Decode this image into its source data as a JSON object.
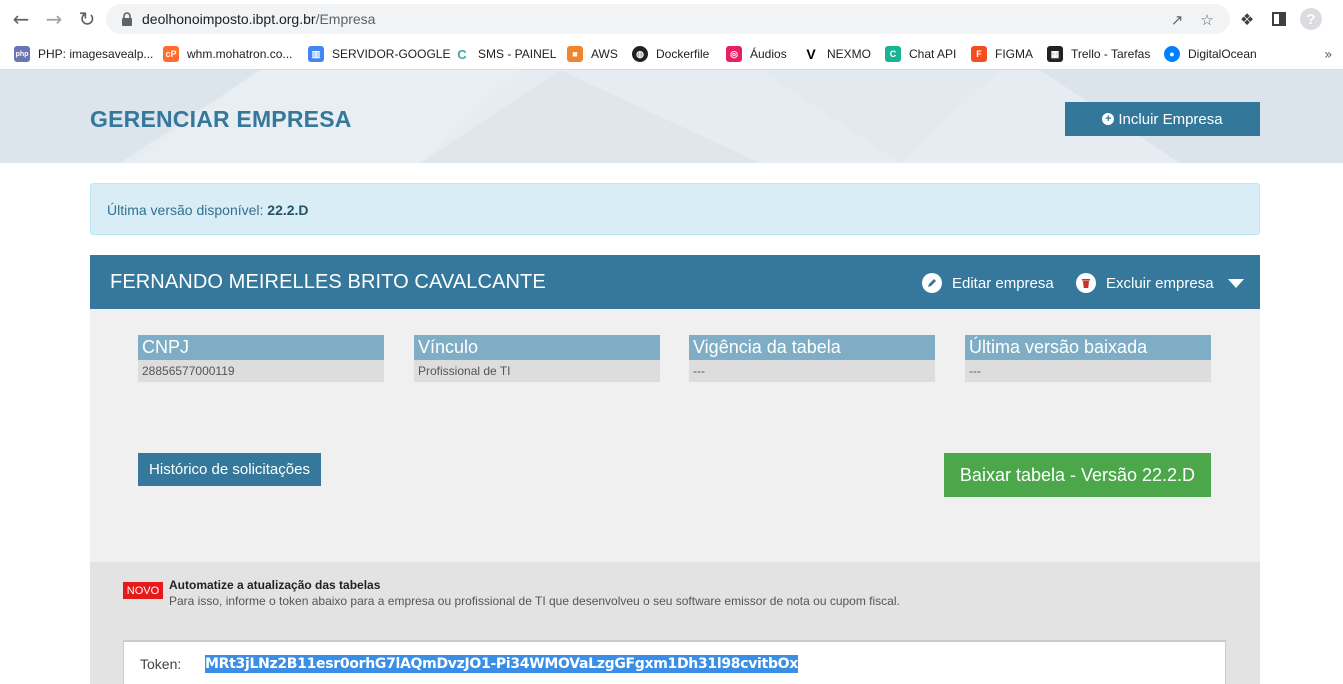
{
  "browser": {
    "url_host": "deolhonoimposto.ibpt.org.br",
    "url_path": "/Empresa",
    "bookmarks": [
      {
        "label": "PHP: imagesavealp...",
        "icon": "php-icon",
        "color": "#6b74b5"
      },
      {
        "label": "whm.mohatron.co...",
        "icon": "cpanel-icon",
        "color": "#ff6c2c"
      },
      {
        "label": "SERVIDOR-GOOGLE",
        "icon": "google-cloud-icon",
        "color": "#4285f4"
      },
      {
        "label": "SMS - PAINEL",
        "icon": "sms-icon",
        "color": "#3aa8a8"
      },
      {
        "label": "AWS",
        "icon": "aws-icon",
        "color": "#f0852d"
      },
      {
        "label": "Dockerfile",
        "icon": "globe-icon",
        "color": "#202124"
      },
      {
        "label": "Áudios",
        "icon": "audio-icon",
        "color": "#e91e63"
      },
      {
        "label": "NEXMO",
        "icon": "nexmo-icon",
        "color": "#000000"
      },
      {
        "label": "Chat API",
        "icon": "chat-api-icon",
        "color": "#1ab394"
      },
      {
        "label": "FIGMA",
        "icon": "figma-icon",
        "color": "#f24e1e"
      },
      {
        "label": "Trello - Tarefas",
        "icon": "trello-icon",
        "color": "#222222"
      },
      {
        "label": "DigitalOcean",
        "icon": "digitalocean-icon",
        "color": "#0080ff"
      }
    ]
  },
  "header": {
    "title": "GERENCIAR EMPRESA",
    "add_button": "Incluir Empresa"
  },
  "alert": {
    "label": "Última versão disponível:",
    "version": "22.2.D"
  },
  "company": {
    "name": "FERNANDO MEIRELLES BRITO CAVALCANTE",
    "edit_label": "Editar empresa",
    "delete_label": "Excluir empresa",
    "fields": [
      {
        "label": "CNPJ",
        "value": "28856577000119"
      },
      {
        "label": "Vínculo",
        "value": "Profissional de TI"
      },
      {
        "label": "Vigência da tabela",
        "value": "---"
      },
      {
        "label": "Última versão baixada",
        "value": "---"
      }
    ],
    "history_button": "Histórico de solicitações",
    "download_button": "Baixar tabela - Versão 22.2.D"
  },
  "automation": {
    "badge": "NOVO",
    "title": "Automatize a atualização das tabelas",
    "description": "Para isso, informe o token abaixo para a empresa ou profissional de TI que desenvolveu o seu software emissor de nota ou cupom fiscal.",
    "token_label": "Token:",
    "token_value": "MRt3jLNz2B11esr0orhG7lAQmDvzJO1-Pi34WMOVaLzgGFgxm1Dh31l98cvitbOx"
  },
  "colors": {
    "primary": "#35789c",
    "success": "#4ba74a",
    "badge": "#e51a1a",
    "alert_bg": "#d9edf7"
  }
}
